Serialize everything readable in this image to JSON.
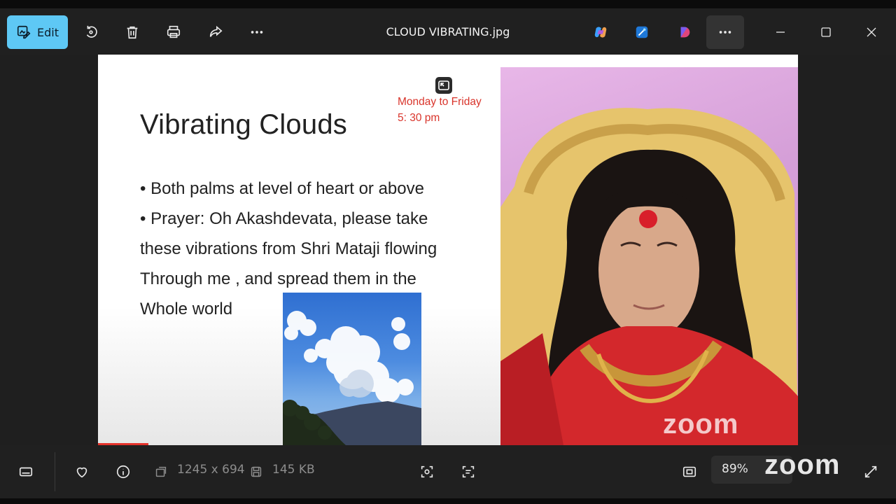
{
  "toolbar": {
    "edit_label": "Edit",
    "file_title": "CLOUD VIBRATING.jpg"
  },
  "slide": {
    "title": "Vibrating Clouds",
    "schedule": [
      "Monday to Friday",
      "5: 30 pm"
    ],
    "bullets": [
      "• Both palms at level of heart or above",
      "• Prayer: Oh Akashdevata, please take",
      "these vibrations from Shri Mataji flowing",
      "Through me , and spread them in the",
      "Whole world"
    ],
    "watermark": "zoom"
  },
  "statusbar": {
    "dimensions": "1245 x 694",
    "file_size": "145 KB",
    "zoom_level": "89%",
    "overlay_logo": "zoom"
  },
  "colors": {
    "accent": "#5ec8f5",
    "schedule_red": "#d9342b",
    "background": "#202020"
  }
}
